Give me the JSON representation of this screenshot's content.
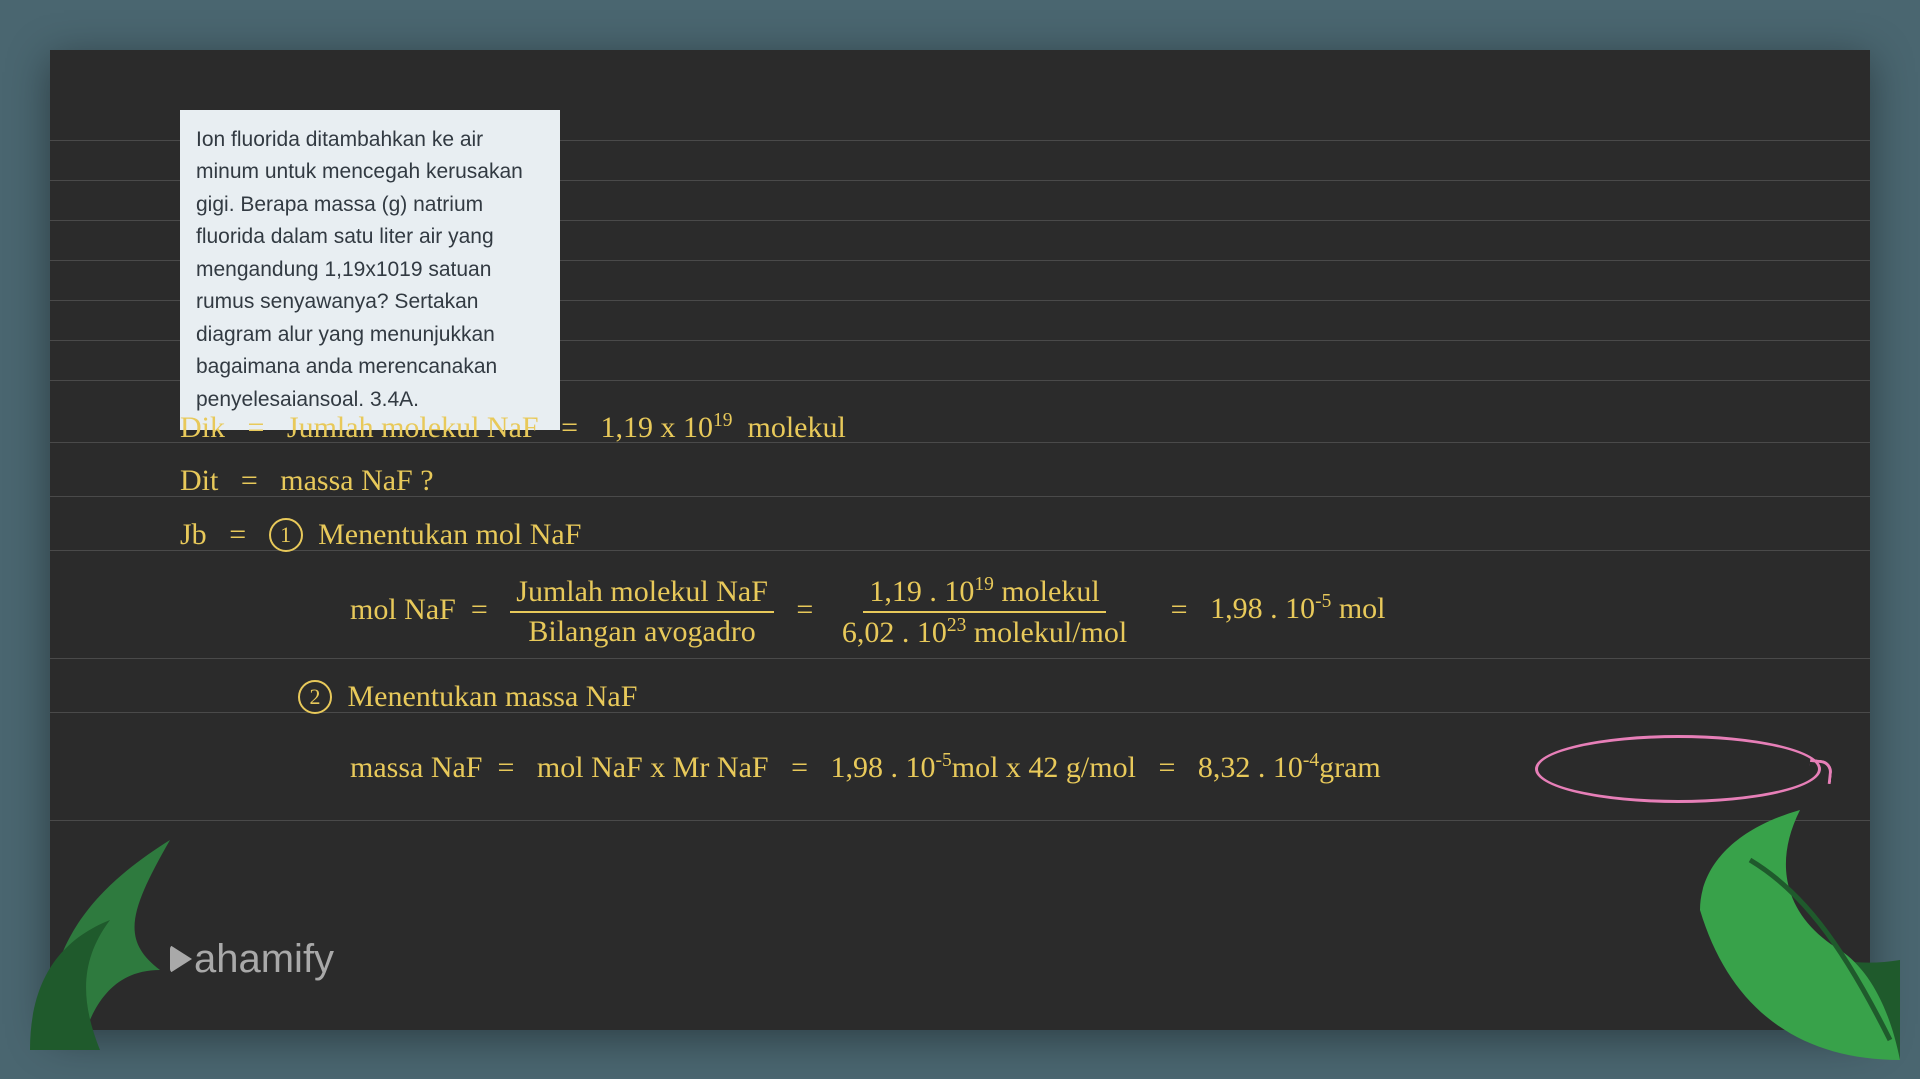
{
  "question": {
    "text": "Ion fluorida ditambahkan ke air minum untuk mencegah kerusakan gigi. Berapa massa (g) natrium fluorida dalam satu liter air yang mengandung 1,19x1019 satuan rumus senyawanya? Sertakan diagram alur yang menunjukkan bagaimana anda merencanakan penyelesaiansoal. 3.4A."
  },
  "work": {
    "dik_label": "Dik",
    "dik_expr1": "Jumlah molekul NaF",
    "dik_value": "1,19 x 10",
    "dik_exp": "19",
    "dik_unit": "molekul",
    "dit_label": "Dit",
    "dit_expr": "massa NaF ?",
    "jb_label": "Jb",
    "step1_num": "1",
    "step1_title": "Menentukan mol NaF",
    "step1_lhs": "mol NaF",
    "step1_frac_top": "Jumlah molekul NaF",
    "step1_frac_bot": "Bilangan avogadro",
    "step1_val_top": "1,19 . 10",
    "step1_val_top_exp": "19",
    "step1_val_top_unit": "molekul",
    "step1_val_bot": "6,02 . 10",
    "step1_val_bot_exp": "23",
    "step1_val_bot_unit": "molekul/mol",
    "step1_result_val": "1,98 . 10",
    "step1_result_exp": "-5",
    "step1_result_unit": "mol",
    "step2_num": "2",
    "step2_title": "Menentukan massa NaF",
    "step2_lhs": "massa NaF",
    "step2_rhs_sym": "mol NaF  x  Mr NaF",
    "step2_val1": "1,98 . 10",
    "step2_val1_exp": "-5",
    "step2_val1_unit": "mol  x  42 g/mol",
    "step2_result_val": "8,32 . 10",
    "step2_result_exp": "-4",
    "step2_result_unit": "gram"
  },
  "brand": "ahamify",
  "eq": "="
}
